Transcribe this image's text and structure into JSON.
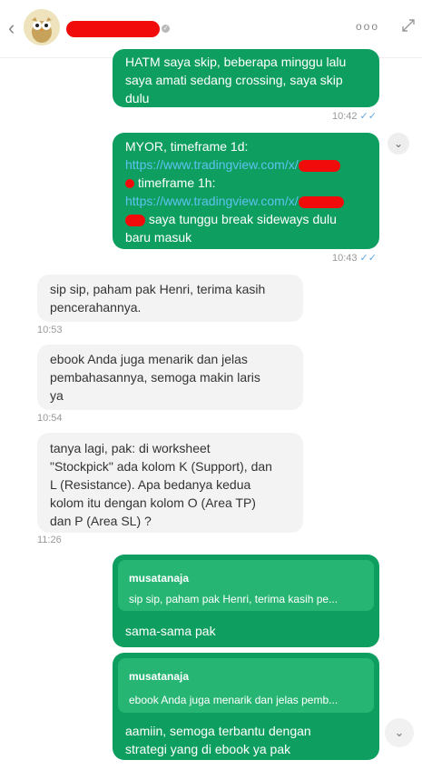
{
  "header": {
    "back_icon": "chevron-left-icon",
    "more_label": "ooo",
    "expand_icon": "expand-icon"
  },
  "messages": [
    {
      "lines": [
        "HATM saya skip, beberapa minggu lalu",
        "saya amati sedang crossing, saya skip",
        "dulu"
      ],
      "time": "10:42"
    },
    {
      "line1": "MYOR, timeframe 1d:",
      "link1": "https://www.tradingview.com/x/",
      "line3": " timeframe 1h:",
      "link2": "https://www.tradingview.com/x/",
      "line5": " saya tunggu break sideways dulu",
      "line6": "baru masuk",
      "time": "10:43"
    },
    {
      "lines": [
        "sip sip, paham pak Henri, terima kasih",
        "pencerahannya."
      ],
      "time": "10:53"
    },
    {
      "lines": [
        "ebook Anda juga menarik dan jelas",
        "pembahasannya, semoga makin laris",
        "ya"
      ],
      "time": "10:54"
    },
    {
      "lines": [
        "tanya lagi, pak: di worksheet",
        "\"Stockpick\" ada kolom K (Support), dan",
        "L (Resistance). Apa bedanya kedua",
        "kolom itu dengan kolom O (Area TP)",
        "dan P (Area SL) ?"
      ],
      "time": "11:26"
    },
    {
      "quote_author": "musatanaja",
      "quote_text": "sip sip, paham pak Henri, terima kasih pe...",
      "text": "sama-sama pak"
    },
    {
      "quote_author": "musatanaja",
      "quote_text": "ebook Anda juga menarik dan jelas pemb...",
      "lines": [
        "aamiin, semoga terbantu dengan",
        "strategi yang di ebook ya pak"
      ]
    }
  ],
  "colors": {
    "outgoing": "#0e9f60",
    "incoming": "#f3f3f3",
    "link": "#5ec1f0",
    "read_ticks": "#60a8e0",
    "redaction": "#f10b0b"
  }
}
